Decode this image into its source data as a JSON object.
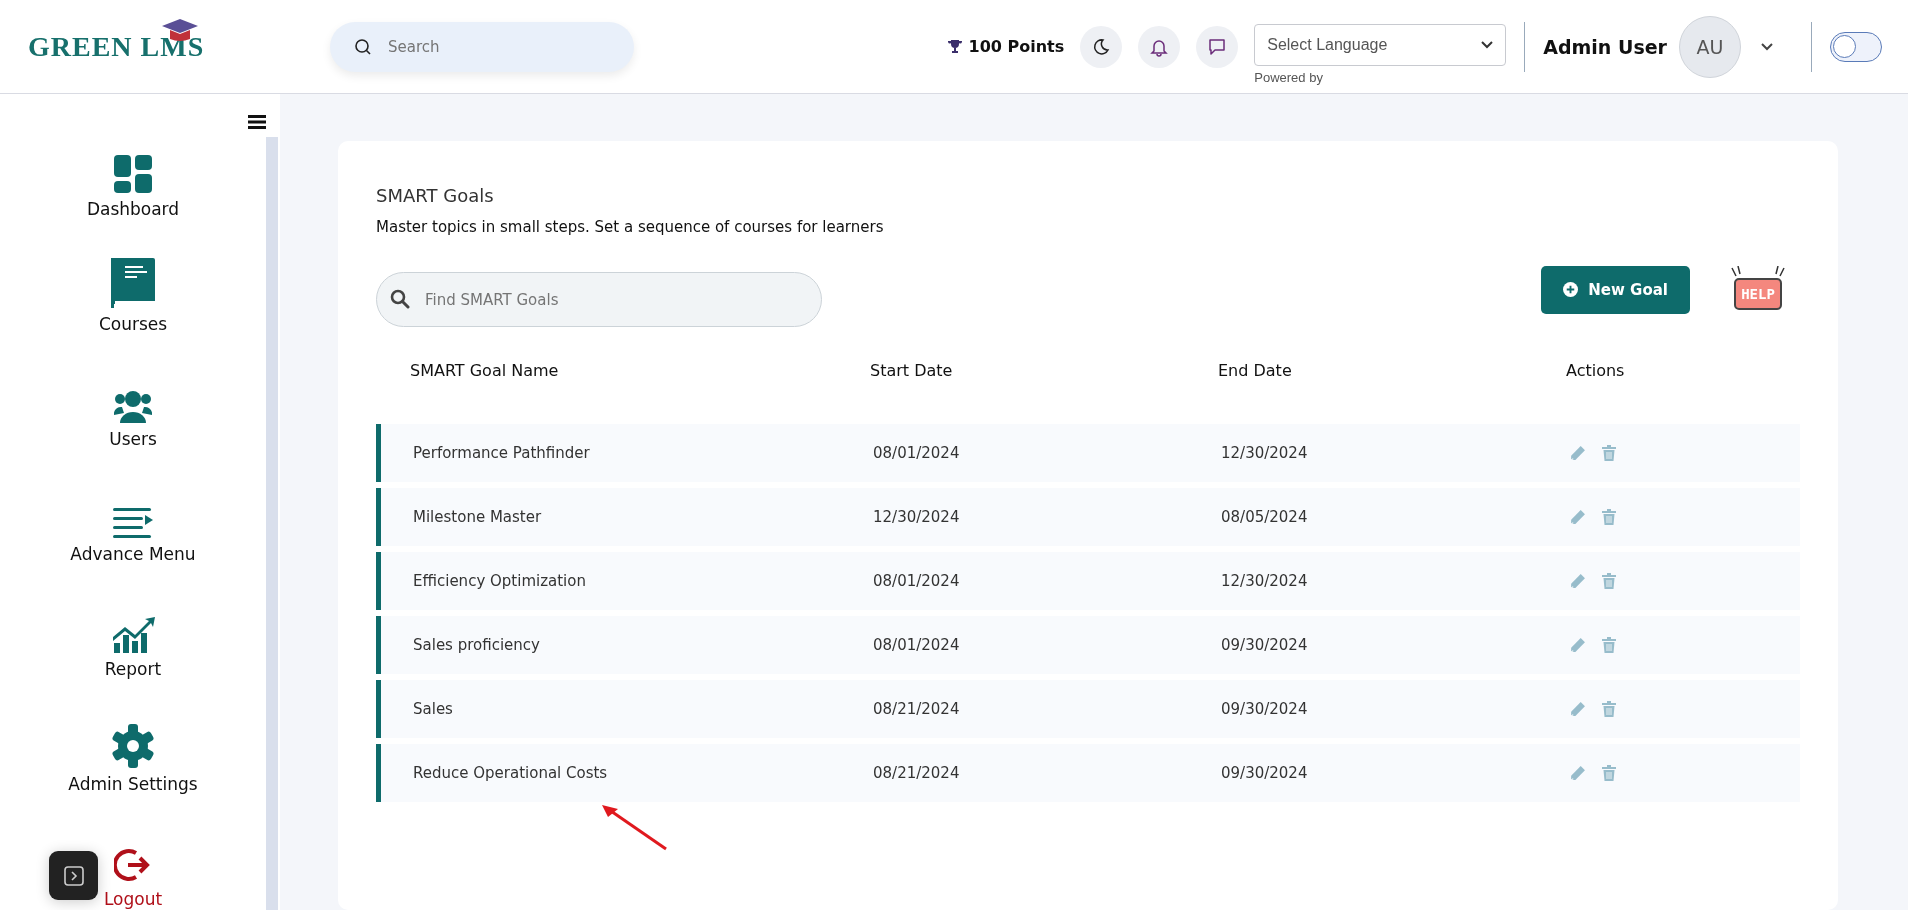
{
  "header": {
    "logo": "GREEN LMS",
    "search": {
      "placeholder": "Search"
    },
    "points": "100 Points",
    "language": {
      "value": "Select Language",
      "note": "Powered by"
    },
    "user": {
      "name": "Admin User",
      "initials": "AU"
    },
    "theme_toggle": {
      "on": false
    }
  },
  "sidebar": {
    "items": [
      {
        "label": "Dashboard",
        "kind": "dashboard"
      },
      {
        "label": "Courses",
        "kind": "courses"
      },
      {
        "label": "Users",
        "kind": "users"
      },
      {
        "label": "Advance Menu",
        "kind": "menu"
      },
      {
        "label": "Report",
        "kind": "report"
      },
      {
        "label": "Admin Settings",
        "kind": "settings"
      },
      {
        "label": "Logout",
        "kind": "logout"
      }
    ]
  },
  "page": {
    "title": "SMART Goals",
    "subtitle": "Master topics in small steps. Set a sequence of courses for learners",
    "search": {
      "placeholder": "Find SMART Goals"
    },
    "new_button": "New Goal",
    "help": "HELP"
  },
  "table": {
    "columns": [
      "SMART Goal Name",
      "Start Date",
      "End Date",
      "Actions"
    ],
    "rows": [
      {
        "name": "Performance Pathfinder",
        "start": "08/01/2024",
        "end": "12/30/2024"
      },
      {
        "name": "Milestone Master",
        "start": "12/30/2024",
        "end": "08/05/2024"
      },
      {
        "name": "Efficiency Optimization",
        "start": "08/01/2024",
        "end": "12/30/2024"
      },
      {
        "name": "Sales proficiency",
        "start": "08/01/2024",
        "end": "09/30/2024"
      },
      {
        "name": "Sales",
        "start": "08/21/2024",
        "end": "09/30/2024"
      },
      {
        "name": "Reduce Operational Costs",
        "start": "08/21/2024",
        "end": "09/30/2024"
      }
    ]
  }
}
